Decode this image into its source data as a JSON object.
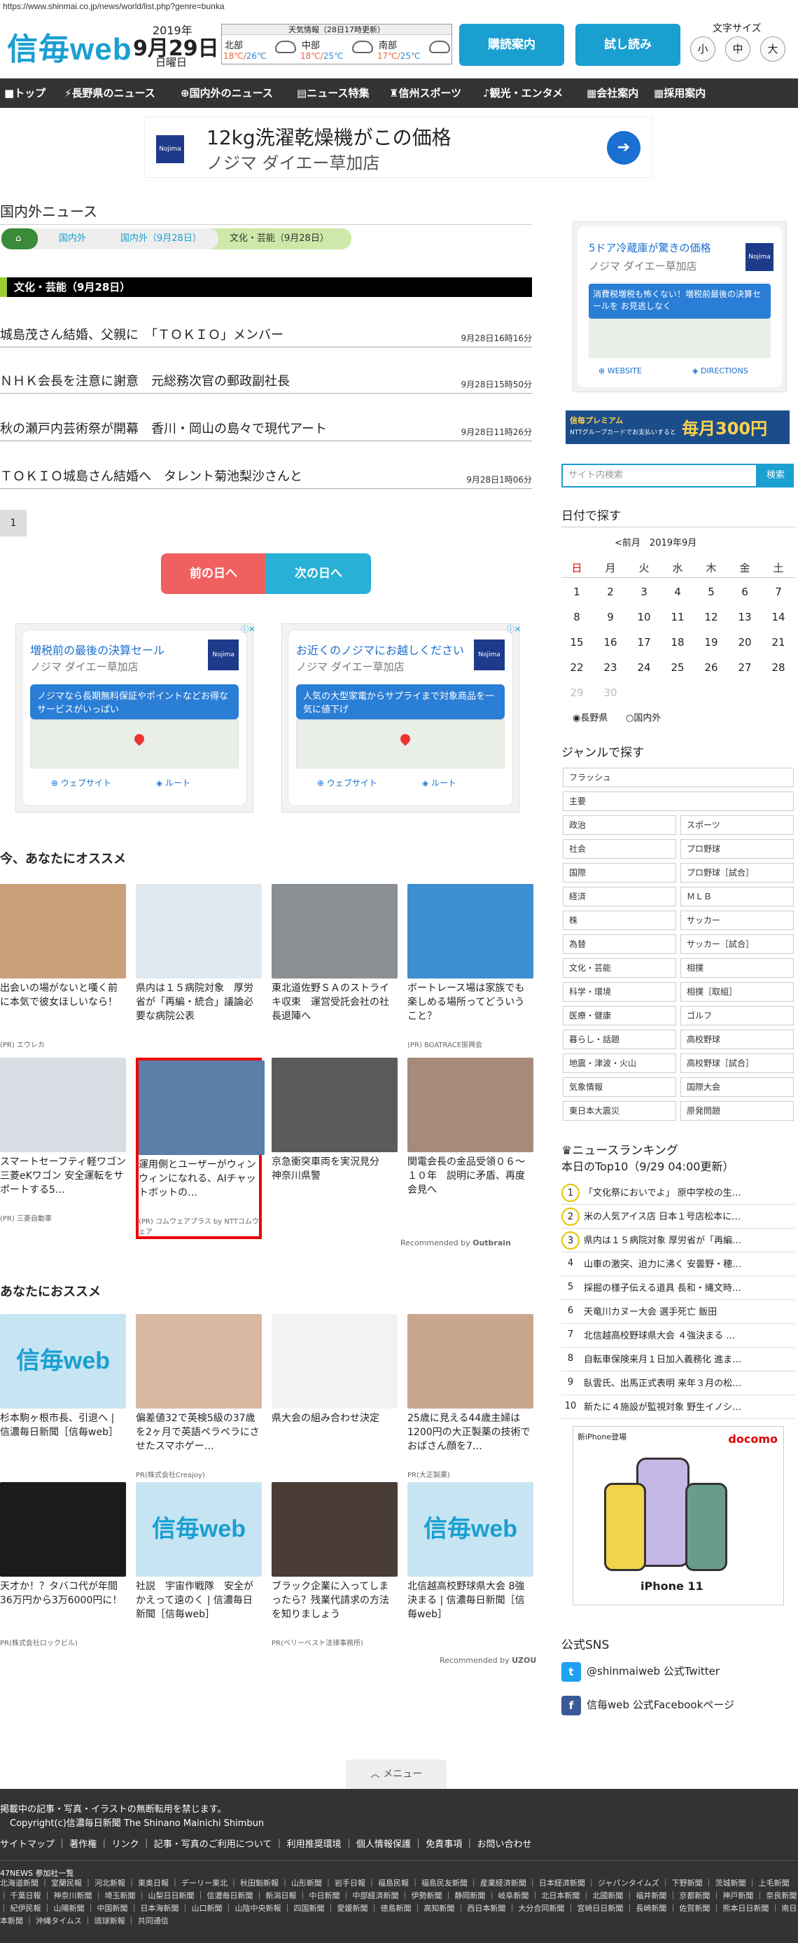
{
  "url": "https://www.shinmai.co.jp/news/world/list.php?genre=bunka",
  "logo": "信毎web",
  "date": {
    "year": "2019年",
    "day": "9月29日",
    "weekday": "日曜日"
  },
  "weather": {
    "title": "天気情報（28日17時更新）",
    "areas": [
      {
        "name": "北部",
        "hi": "18℃",
        "lo": "26℃"
      },
      {
        "name": "中部",
        "hi": "18℃",
        "lo": "25℃"
      },
      {
        "name": "南部",
        "hi": "17℃",
        "lo": "25℃"
      }
    ]
  },
  "header": {
    "subscribe": "購読案内",
    "trial": "試し読み",
    "font_size_label": "文字サイズ",
    "font_sizes": [
      "小",
      "中",
      "大"
    ]
  },
  "nav": [
    "トップ",
    "長野県のニュース",
    "国内外のニュース",
    "ニュース特集",
    "信州スポーツ",
    "観光・エンタメ",
    "会社案内",
    "採用案内"
  ],
  "top_ad": {
    "brand": "Nojima",
    "line1": "12kg洗濯乾燥機がこの価格",
    "line2": "ノジマ ダイエー草加店"
  },
  "section": {
    "title": "国内外ニュース",
    "crumbs": [
      "国内外",
      "国内外（9月28日）",
      "文化・芸能（9月28日）"
    ],
    "category": "文化・芸能（9月28日）"
  },
  "articles": [
    {
      "title": "城島茂さん結婚、父親に　「ＴＯＫＩＯ」メンバー",
      "date": "9月28日16時16分"
    },
    {
      "title": "ＮＨＫ会長を注意に謝意　元総務次官の郵政副社長",
      "date": "9月28日15時50分"
    },
    {
      "title": "秋の瀬戸内芸術祭が開幕　香川・岡山の島々で現代アート",
      "date": "9月28日11時26分"
    },
    {
      "title": "ＴＯＫＩＯ城島さん結婚へ　タレント菊池梨沙さんと",
      "date": "9月28日1時06分"
    }
  ],
  "pager": {
    "page": "1",
    "prev": "前の日へ",
    "next": "次の日へ"
  },
  "map_ads": [
    {
      "headline": "増税前の最後の決算セール",
      "shop": "ノジマ ダイエー草加店",
      "body": "ノジマなら長期無料保証やポイントなどお得なサービスがいっぱい",
      "b1": "ウェブサイト",
      "b2": "ルート"
    },
    {
      "headline": "お近くのノジマにお越しください",
      "shop": "ノジマ ダイエー草加店",
      "body": "人気の大型家電からサプライまで対象商品を一気に値下げ",
      "b1": "ウェブサイト",
      "b2": "ルート"
    }
  ],
  "reco": {
    "title": "今、あなたにオススメ",
    "items": [
      {
        "caption": "出会いの場がないと嘆く前に本気で彼女ほしいなら！",
        "source": "(PR) エウレカ",
        "color": "#c9a07a"
      },
      {
        "caption": "県内は１５病院対象　厚労省が「再編・統合」議論必要な病院公表",
        "source": "",
        "color": "#dfe8ef"
      },
      {
        "caption": "東北道佐野ＳＡのストライキ収束　運営受託会社の社長退陣へ",
        "source": "",
        "color": "#8a8f93"
      },
      {
        "caption": "ボートレース場は家族でも楽しめる場所ってどういうこと？",
        "source": "(PR) BOATRACE振興会",
        "color": "#3d8fd1"
      },
      {
        "caption": "スマートセーフティ軽ワゴン三菱eKワゴン 安全運転をサポートする5…",
        "source": "(PR) 三菱自動車",
        "color": "#d7dde2"
      },
      {
        "caption": "運用側とユーザーがウィンウィンになれる、AIチャットボットの…",
        "source": "(PR) コムウェアプラス by NTTコムウェア",
        "color": "#5a7fa8"
      },
      {
        "caption": "京急衝突車両を実況見分　神奈川県警",
        "source": "",
        "color": "#5b5b5b"
      },
      {
        "caption": "関電会長の金品受領０６～１０年　説明に矛盾、再度会見へ",
        "source": "",
        "color": "#a68a7a"
      }
    ],
    "recommended_by": "Recommended by",
    "outbrain": "Outbrain"
  },
  "reco2": {
    "title": "あなたにおススメ",
    "items": [
      {
        "caption": "杉本駒ヶ根市長、引退へ | 信濃毎日新聞［信毎web］",
        "source": "",
        "color": "#c7e4f3",
        "logo": true
      },
      {
        "caption": "偏差値32で英検5級の37歳を2ヶ月で英語ペラペラにさせたスマホゲー…",
        "source": "PR(株式会社Creajoy)",
        "color": "#d8b8a0"
      },
      {
        "caption": "県大会の組み合わせ決定",
        "source": "",
        "color": "#f2f2f2"
      },
      {
        "caption": "25歳に見える44歳主婦は1200円の大正製薬の技術でおばさん顔を7…",
        "source": "PR(大正製薬)",
        "color": "#c9a68e"
      },
      {
        "caption": "天才か！？タバコ代が年間36万円から3万6000円に！",
        "source": "PR(株式会社ロックビル)",
        "color": "#1b1b1b"
      },
      {
        "caption": "社説　宇宙作戦隊　安全がかえって遠のく | 信濃毎日新聞［信毎web］",
        "source": "",
        "color": "#c7e4f3",
        "logo": true
      },
      {
        "caption": "ブラック企業に入ってしまったら？残業代請求の方法を知りましょう",
        "source": "PR(ベリーベスト法律事務所)",
        "color": "#4a3d35"
      },
      {
        "caption": "北信越高校野球県大会 8強決まる | 信濃毎日新聞［信毎web］",
        "source": "",
        "color": "#c7e4f3",
        "logo": true
      }
    ],
    "recommended_by": "Recommended by",
    "uzou": "UZOU"
  },
  "side_ad": {
    "headline": "5ドア冷蔵庫が驚きの価格",
    "shop": "ノジマ ダイエー草加店",
    "body": "消費税増税も怖くない！増税前最後の決算セールを お見逃しなく",
    "b1": "WEBSITE",
    "b2": "DIRECTIONS"
  },
  "premium": {
    "a": "信毎プレミアム",
    "b": "NTTグループカードでお支払いすると",
    "c": "毎月300円"
  },
  "search": {
    "placeholder": "サイト内検索",
    "button": "検索"
  },
  "calendar": {
    "title": "日付で探す",
    "prev": "<前月",
    "month": "2019年9月",
    "weekdays": [
      "日",
      "月",
      "火",
      "水",
      "木",
      "金",
      "土"
    ],
    "weeks": [
      [
        "1",
        "2",
        "3",
        "4",
        "5",
        "6",
        "7"
      ],
      [
        "8",
        "9",
        "10",
        "11",
        "12",
        "13",
        "14"
      ],
      [
        "15",
        "16",
        "17",
        "18",
        "19",
        "20",
        "21"
      ],
      [
        "22",
        "23",
        "24",
        "25",
        "26",
        "27",
        "28"
      ],
      [
        "29",
        "30",
        "",
        "",
        "",
        "",
        ""
      ]
    ],
    "radio": [
      "長野県",
      "国内外"
    ]
  },
  "genre": {
    "title": "ジャンルで探す",
    "full": [
      "フラッシュ",
      "主要"
    ],
    "pairs": [
      [
        "政治",
        "スポーツ"
      ],
      [
        "社会",
        "プロ野球"
      ],
      [
        "国際",
        "プロ野球［試合］"
      ],
      [
        "経済",
        "ＭＬＢ"
      ],
      [
        "株",
        "サッカー"
      ],
      [
        "為替",
        "サッカー［試合］"
      ],
      [
        "文化・芸能",
        "相撲"
      ],
      [
        "科学・環境",
        "相撲［取組］"
      ],
      [
        "医療・健康",
        "ゴルフ"
      ],
      [
        "暮らし・話題",
        "高校野球"
      ],
      [
        "地震・津波・火山",
        "高校野球［試合］"
      ],
      [
        "気象情報",
        "国際大会"
      ],
      [
        "東日本大震災",
        "原発問題"
      ]
    ]
  },
  "ranking": {
    "title": "ニュースランキング",
    "subtitle": "本日のTop10（9/29 04:00更新）",
    "items": [
      "「文化祭においでよ」 原中学校の生…",
      "米の人気アイス店 日本１号店松本に…",
      "県内は１５病院対象 厚労省が「再編…",
      "山車の激突、迫力に沸く 安曇野・穂…",
      "採掘の様子伝える道具 長和・縄文時…",
      "天竜川カヌー大会 選手死亡 飯田",
      "北信越高校野球県大会 ４強決まる …",
      "自転車保険来月１日加入義務化 進ま…",
      "臥雲氏、出馬正式表明 来年３月の松…",
      "新たに４施設が監視対象 野生イノシ…"
    ]
  },
  "docomo": {
    "top": "新iPhone登場",
    "brand": "docomo",
    "model": "iPhone 11"
  },
  "sns": {
    "title": "公式SNS",
    "twitter": "@shinmaiweb 公式Twitter",
    "facebook": "信毎web 公式Facebookページ"
  },
  "footer": {
    "menu": "メニュー",
    "notice": "掲載中の記事・写真・イラストの無断転用を禁じます。",
    "copyright": "Copyright(c)信濃毎日新聞 The Shinano Mainichi Shimbun",
    "links": "サイトマップ ｜ 著作権 ｜ リンク ｜ 記事・写真のご利用について ｜ 利用推奨環境 ｜ 個人情報保護 ｜ 免責事項 ｜ お問い合わせ",
    "np": "47NEWS 参加社一覧",
    "papers": "北海道新聞 ｜ 室蘭民報 ｜ 河北新報 ｜ 東奥日報 ｜ デーリー東北 ｜ 秋田魁新報 ｜ 山形新聞 ｜ 岩手日報 ｜ 福島民報 ｜ 福島民友新聞 ｜ 産業経済新聞 ｜ 日本経済新聞 ｜ ジャパンタイムズ ｜ 下野新聞 ｜ 茨城新聞 ｜ 上毛新聞 ｜ 千葉日報 ｜ 神奈川新聞 ｜ 埼玉新聞 ｜ 山梨日日新聞 ｜ 信濃毎日新聞 ｜ 新潟日報 ｜ 中日新聞 ｜ 中部経済新聞 ｜ 伊勢新聞 ｜ 静岡新聞 ｜ 岐阜新聞 ｜ 北日本新聞 ｜ 北國新聞 ｜ 福井新聞 ｜ 京都新聞 ｜ 神戸新聞 ｜ 奈良新聞 ｜ 紀伊民報 ｜ 山陽新聞 ｜ 中国新聞 ｜ 日本海新聞 ｜ 山口新聞 ｜ 山陰中央新報 ｜ 四国新聞 ｜ 愛媛新聞 ｜ 徳島新聞 ｜ 高知新聞 ｜ 西日本新聞 ｜ 大分合同新聞 ｜ 宮崎日日新聞 ｜ 長崎新聞 ｜ 佐賀新聞 ｜ 熊本日日新聞 ｜ 南日本新聞 ｜ 沖縄タイムス ｜ 琉球新報 ｜ 共同通信"
  }
}
